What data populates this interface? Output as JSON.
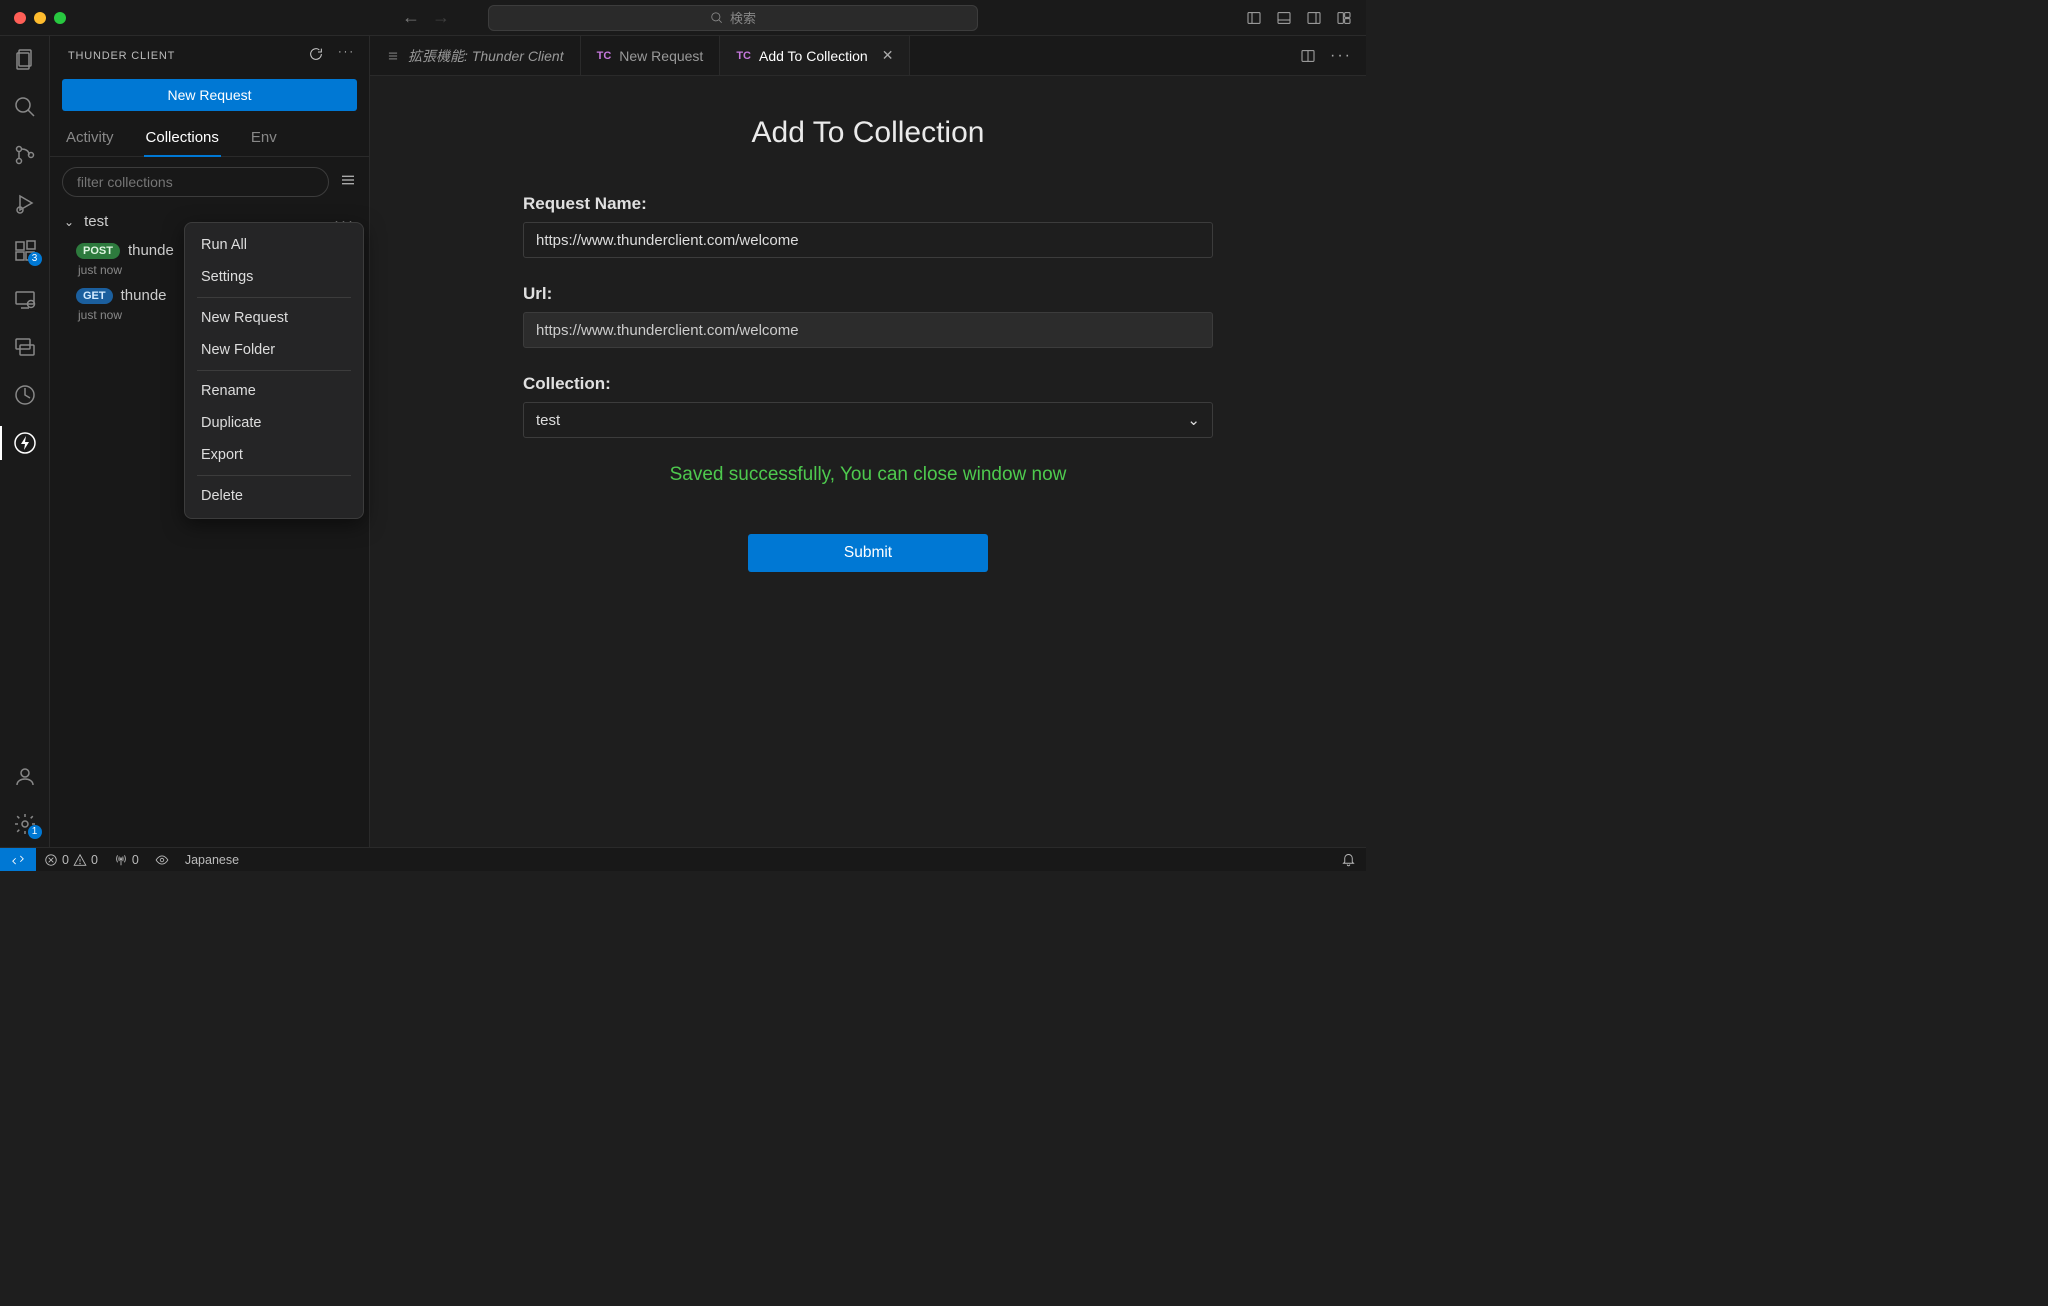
{
  "titlebar": {
    "search_placeholder": "検索"
  },
  "activitybar": {
    "badge_extensions": "3",
    "badge_settings": "1"
  },
  "sidepanel": {
    "title": "THUNDER CLIENT",
    "new_request_label": "New Request",
    "subtabs": {
      "activity": "Activity",
      "collections": "Collections",
      "env": "Env"
    },
    "filter_placeholder": "filter collections",
    "collection_name": "test",
    "requests": [
      {
        "method": "POST",
        "name": "thunde",
        "time": "just now"
      },
      {
        "method": "GET",
        "name": "thunde",
        "time": "just now"
      }
    ]
  },
  "context_menu": {
    "run_all": "Run All",
    "settings": "Settings",
    "new_request": "New Request",
    "new_folder": "New Folder",
    "rename": "Rename",
    "duplicate": "Duplicate",
    "export": "Export",
    "delete": "Delete"
  },
  "tabs": {
    "ext_label": "拡張機能: Thunder Client",
    "newreq_label": "New Request",
    "addcoll_label": "Add To Collection",
    "tc_badge": "TC"
  },
  "form": {
    "heading": "Add To Collection",
    "request_name_label": "Request Name:",
    "request_name_value": "https://www.thunderclient.com/welcome",
    "url_label": "Url:",
    "url_value": "https://www.thunderclient.com/welcome",
    "collection_label": "Collection:",
    "collection_value": "test",
    "saved_message": "Saved successfully, You can close window now",
    "submit_label": "Submit"
  },
  "statusbar": {
    "errors": "0",
    "warnings": "0",
    "ports": "0",
    "language": "Japanese"
  }
}
